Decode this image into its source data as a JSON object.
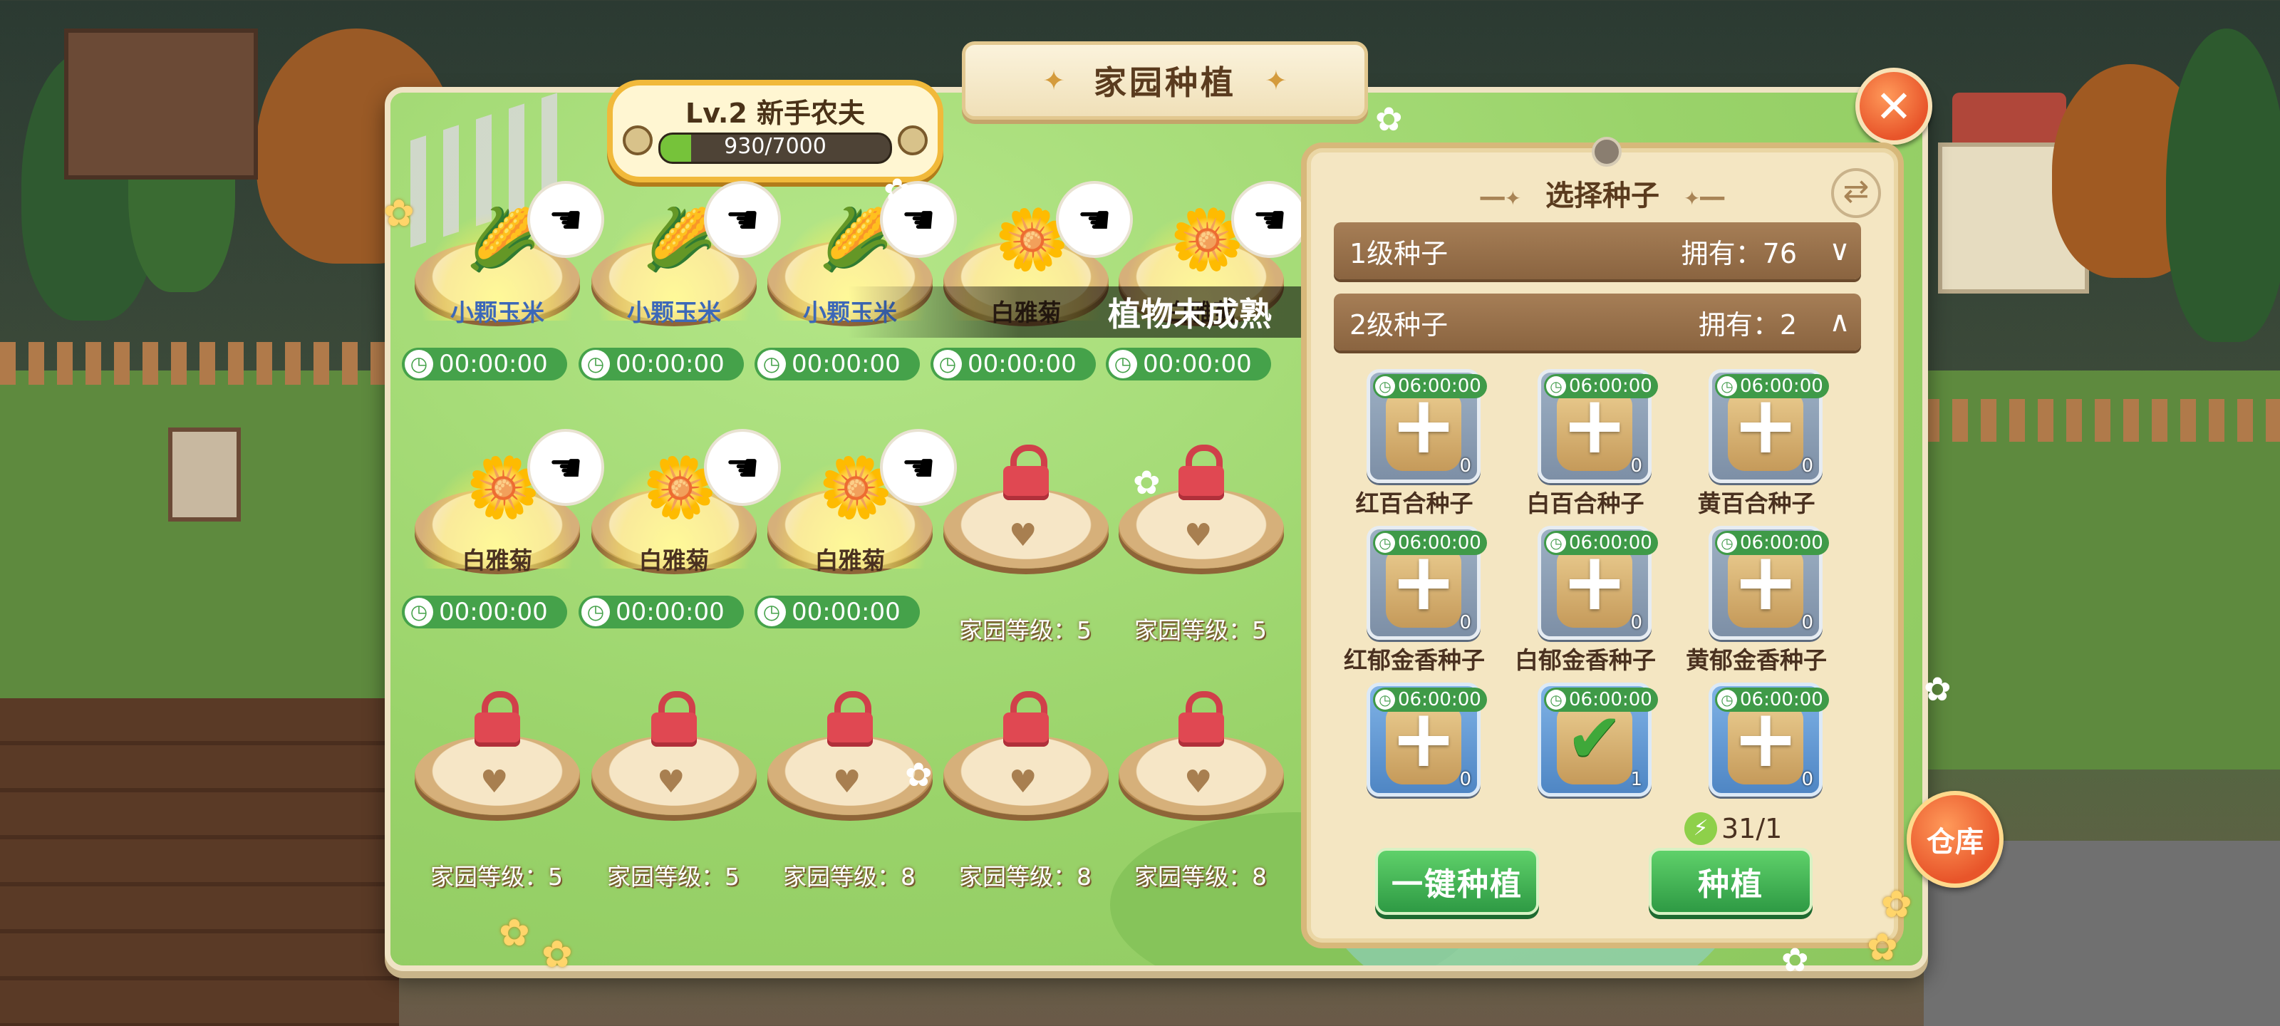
{
  "title": "家园种植",
  "level": {
    "label": "Lv.2 新手农夫",
    "xp_text": "930/7000",
    "xp_fraction": 0.133
  },
  "toast": "植物未成熟",
  "plots": [
    {
      "type": "crop",
      "crop": "corn",
      "name": "小颗玉米",
      "timer": "00:00:00"
    },
    {
      "type": "crop",
      "crop": "corn",
      "name": "小颗玉米",
      "timer": "00:00:00"
    },
    {
      "type": "crop",
      "crop": "corn",
      "name": "小颗玉米",
      "timer": "00:00:00"
    },
    {
      "type": "crop",
      "crop": "daisy",
      "name": "白雅菊",
      "timer": "00:00:00"
    },
    {
      "type": "crop",
      "crop": "daisy",
      "name": "白雅菊",
      "timer": "00:00:00"
    },
    {
      "type": "crop",
      "crop": "daisy",
      "name": "白雅菊",
      "timer": "00:00:00"
    },
    {
      "type": "crop",
      "crop": "daisy",
      "name": "白雅菊",
      "timer": "00:00:00"
    },
    {
      "type": "crop",
      "crop": "daisy",
      "name": "白雅菊",
      "timer": "00:00:00"
    },
    {
      "type": "locked",
      "label": "家园等级：5"
    },
    {
      "type": "locked",
      "label": "家园等级：5"
    },
    {
      "type": "locked",
      "label": "家园等级：5"
    },
    {
      "type": "locked",
      "label": "家园等级：5"
    },
    {
      "type": "locked",
      "label": "家园等级：8"
    },
    {
      "type": "locked",
      "label": "家园等级：8"
    },
    {
      "type": "locked",
      "label": "家园等级：8"
    }
  ],
  "seed_panel": {
    "header": "选择种子",
    "categories": [
      {
        "label": "1级种子",
        "owned": "拥有：76",
        "expanded": false,
        "chevron": "∨"
      },
      {
        "label": "2级种子",
        "owned": "拥有：2",
        "expanded": true,
        "chevron": "∧"
      }
    ],
    "seeds": [
      {
        "name": "红百合种子",
        "timer": "06:00:00",
        "count": "0",
        "selected": false
      },
      {
        "name": "白百合种子",
        "timer": "06:00:00",
        "count": "0",
        "selected": false
      },
      {
        "name": "黄百合种子",
        "timer": "06:00:00",
        "count": "0",
        "selected": false
      },
      {
        "name": "红郁金香种子",
        "timer": "06:00:00",
        "count": "0",
        "selected": false
      },
      {
        "name": "白郁金香种子",
        "timer": "06:00:00",
        "count": "0",
        "selected": false
      },
      {
        "name": "黄郁金香种子",
        "timer": "06:00:00",
        "count": "0",
        "selected": false
      },
      {
        "name": "",
        "timer": "06:00:00",
        "count": "0",
        "selected": false
      },
      {
        "name": "",
        "timer": "06:00:00",
        "count": "1",
        "selected": true
      },
      {
        "name": "",
        "timer": "06:00:00",
        "count": "0",
        "selected": false
      }
    ],
    "energy": "31/1",
    "plant_all_label": "一键种植",
    "plant_label": "种植"
  },
  "warehouse_label": "仓库",
  "colors": {
    "accent": "#e8552a",
    "panel_green": "#9bd86e",
    "button_green": "#2e9a44",
    "corn_name": "#3c68b8"
  }
}
